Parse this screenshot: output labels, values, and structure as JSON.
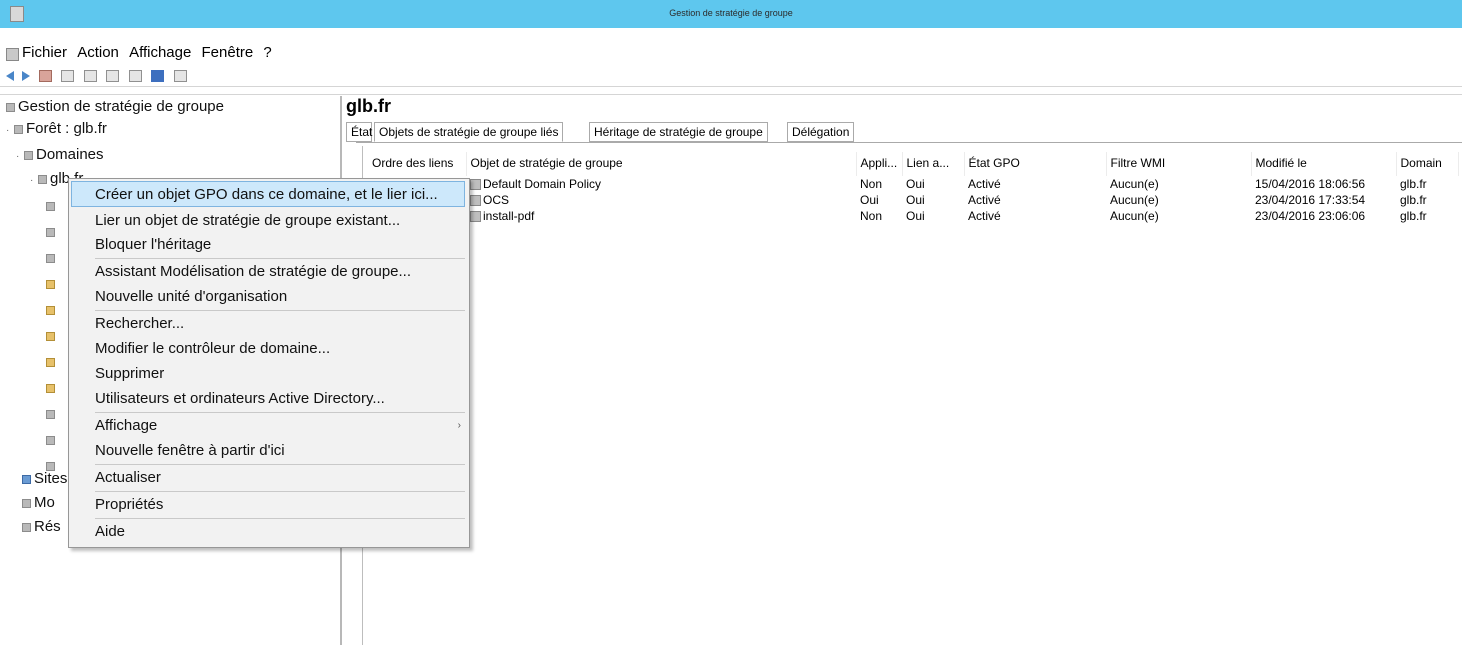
{
  "window": {
    "title": "Gestion de stratégie de groupe"
  },
  "menubar": [
    "Fichier",
    "Action",
    "Affichage",
    "Fenêtre",
    "?"
  ],
  "tree": {
    "root": "Gestion de stratégie de groupe",
    "forest": "Forêt : glb.fr",
    "domains": "Domaines",
    "domain_partial": "glb.fr",
    "sites": "Sites",
    "modeling": "Mo",
    "results": "Rés"
  },
  "panel": {
    "title": "glb.fr",
    "tabs": [
      "État",
      "Objets de stratégie de groupe liés",
      "Héritage de stratégie de groupe",
      "Délégation"
    ],
    "columns": [
      "Ordre des liens",
      "Objet de stratégie de groupe",
      "Appli...",
      "Lien a...",
      "État GPO",
      "Filtre WMI",
      "Modifié le",
      "Domain"
    ],
    "rows": [
      {
        "order": "",
        "name": "Default Domain Policy",
        "applied": "Non",
        "link": "Oui",
        "state": "Activé",
        "wmi": "Aucun(e)",
        "modified": "15/04/2016 18:06:56",
        "domain": "glb.fr"
      },
      {
        "order": "",
        "name": "OCS",
        "applied": "Oui",
        "link": "Oui",
        "state": "Activé",
        "wmi": "Aucun(e)",
        "modified": "23/04/2016 17:33:54",
        "domain": "glb.fr"
      },
      {
        "order": "",
        "name": "install-pdf",
        "applied": "Non",
        "link": "Oui",
        "state": "Activé",
        "wmi": "Aucun(e)",
        "modified": "23/04/2016 23:06:06",
        "domain": "glb.fr"
      }
    ]
  },
  "context_menu": {
    "items": [
      "Créer un objet GPO dans ce domaine, et le lier ici...",
      "Lier un objet de stratégie de groupe existant...",
      "Bloquer l'héritage",
      "Assistant Modélisation de stratégie de groupe...",
      "Nouvelle unité d'organisation",
      "Rechercher...",
      "Modifier le contrôleur de domaine...",
      "Supprimer",
      "Utilisateurs et ordinateurs Active Directory...",
      "Affichage",
      "Nouvelle fenêtre à partir d'ici",
      "Actualiser",
      "Propriétés",
      "Aide"
    ]
  }
}
